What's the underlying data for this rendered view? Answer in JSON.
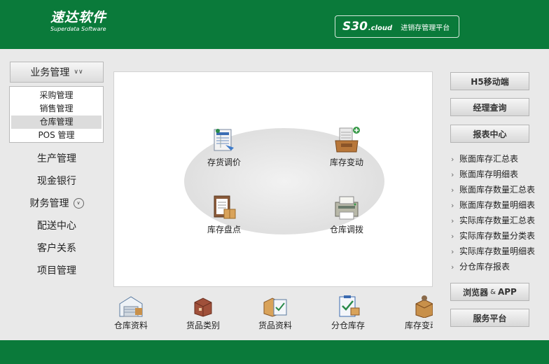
{
  "colors": {
    "brand_green": "#0a7a3a",
    "background": "#e9e9e9"
  },
  "header": {
    "logo_main": "速达软件",
    "logo_sub": "Superdata Software",
    "brand_product": "S30",
    "brand_suffix": ".cloud",
    "brand_slogan": "进销存管理平台"
  },
  "nav": {
    "group_label": "业务管理",
    "submenu": [
      "采购管理",
      "销售管理",
      "仓库管理",
      "POS 管理"
    ],
    "active_submenu": "仓库管理",
    "items": [
      "生产管理",
      "现金银行",
      "财务管理",
      "配送中心",
      "客户关系",
      "项目管理"
    ]
  },
  "center": {
    "modules": [
      {
        "label": "存货调价",
        "icon": "document-arrow-icon"
      },
      {
        "label": "库存变动",
        "icon": "inbox-tray-icon"
      },
      {
        "label": "库存盘点",
        "icon": "clipboard-box-icon"
      },
      {
        "label": "仓库调拨",
        "icon": "printer-icon"
      }
    ],
    "quick_links": [
      {
        "label": "仓库资料",
        "icon": "warehouse-icon"
      },
      {
        "label": "货品类别",
        "icon": "box-stack-icon"
      },
      {
        "label": "货品资料",
        "icon": "box-check-icon"
      },
      {
        "label": "分仓库存",
        "icon": "clipboard-check-icon"
      },
      {
        "label": "库存变动",
        "icon": "box-icon"
      }
    ]
  },
  "right": {
    "mobile_btn": "H5移动端",
    "manager_btn": "经理查询",
    "report_btn": "报表中心",
    "reports": [
      "账面库存汇总表",
      "账面库存明细表",
      "账面库存数量汇总表",
      "账面库存数量明细表",
      "实际库存数量汇总表",
      "实际库存数量分类表",
      "实际库存数量明细表",
      "分仓库存报表"
    ],
    "browser_btn_a": "浏览器",
    "browser_btn_amp": "&",
    "browser_btn_b": "APP",
    "service_btn": "服务平台"
  }
}
